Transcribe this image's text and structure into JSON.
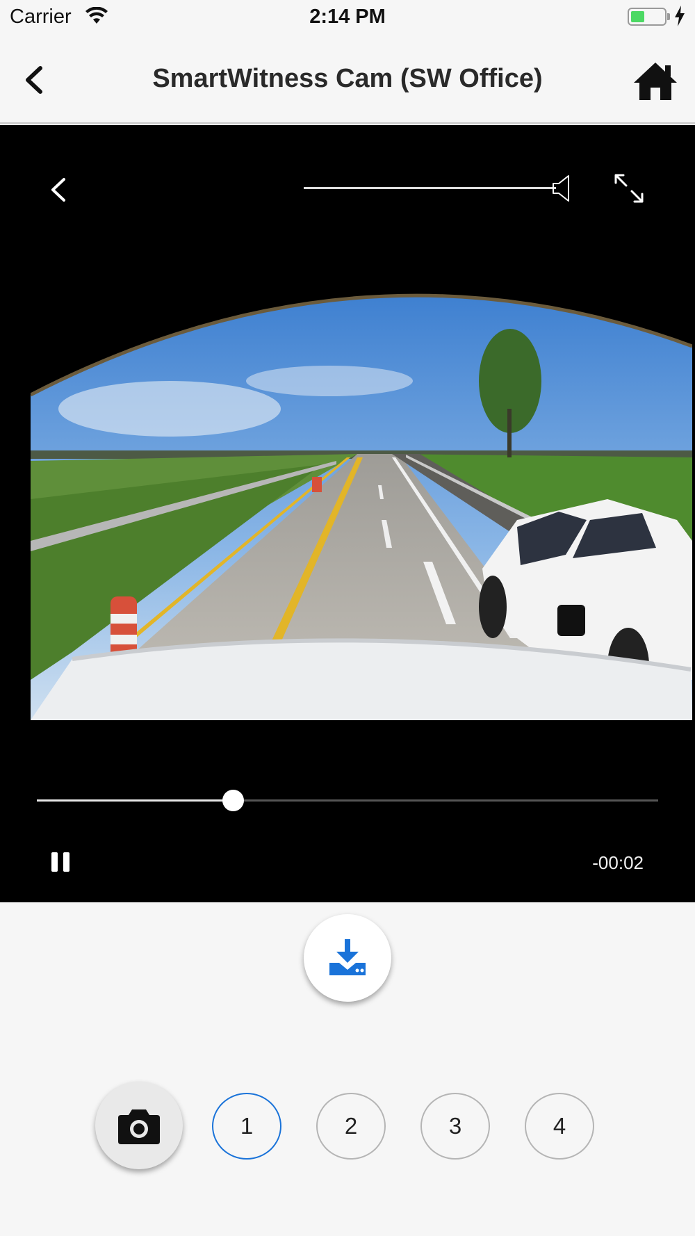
{
  "status_bar": {
    "carrier": "Carrier",
    "time": "2:14 PM",
    "battery_level": 0.4,
    "charging": true
  },
  "nav": {
    "title": "SmartWitness Cam (SW Office)",
    "back_icon": "chevron-left-icon",
    "home_icon": "home-icon"
  },
  "player": {
    "volume_level": 1.0,
    "progress": 0.315,
    "time_remaining": "-00:02",
    "state": "playing",
    "video_description_icon": "dashcam-frame"
  },
  "actions": {
    "download_icon": "download-icon",
    "snapshot_icon": "camera-icon"
  },
  "channels": [
    {
      "label": "1",
      "active": true
    },
    {
      "label": "2",
      "active": false
    },
    {
      "label": "3",
      "active": false
    },
    {
      "label": "4",
      "active": false
    }
  ],
  "colors": {
    "accent": "#1a73d9",
    "background": "#f6f6f6",
    "player_bg": "#000000",
    "battery": "#4cd964"
  }
}
